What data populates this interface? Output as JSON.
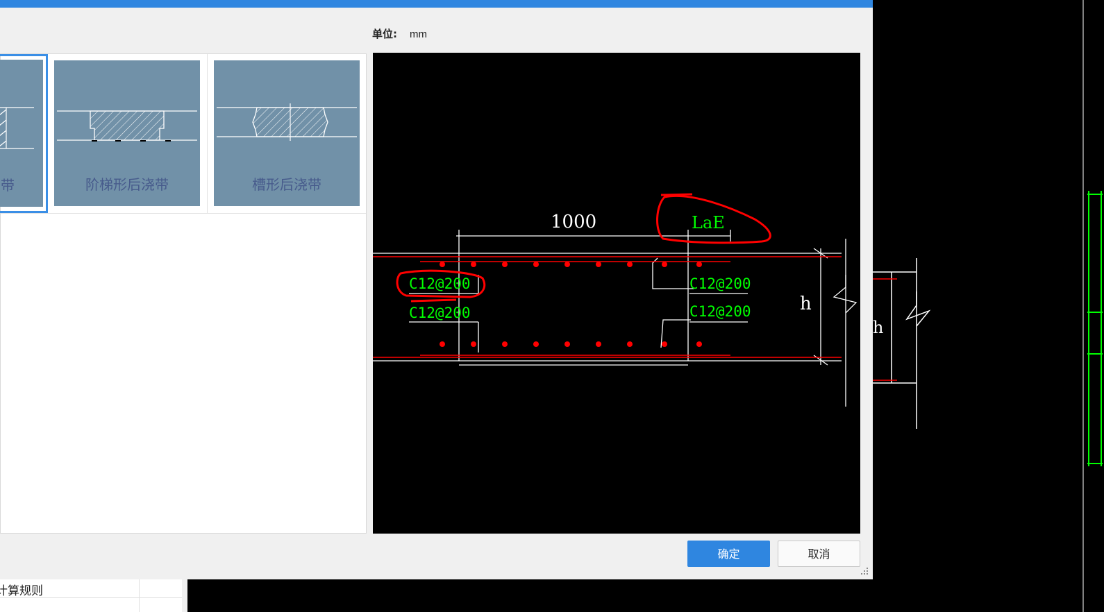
{
  "dialog": {
    "unit_label": "单位:",
    "unit_value": "mm",
    "types": [
      {
        "label": "带",
        "selected": true
      },
      {
        "label": "阶梯形后浇带",
        "selected": false
      },
      {
        "label": "槽形后浇带",
        "selected": false
      }
    ],
    "ok_label": "确定",
    "cancel_label": "取消"
  },
  "preview": {
    "dim_length": "1000",
    "lae_label": "LaE",
    "rebar_top_left": "C12@200",
    "rebar_bottom_left": "C12@200",
    "rebar_top_right": "C12@200",
    "rebar_bottom_right": "C12@200",
    "h_label": "h"
  },
  "background_cad": {
    "h_label": "h"
  },
  "bottom_panel": {
    "label": "计算规则"
  },
  "colors": {
    "accent": "#2f86e0",
    "thumb_bg": "#7191a8",
    "rebar_text": "#00ff00",
    "rebar_line": "#ff0000",
    "annotation": "#ff0000"
  }
}
